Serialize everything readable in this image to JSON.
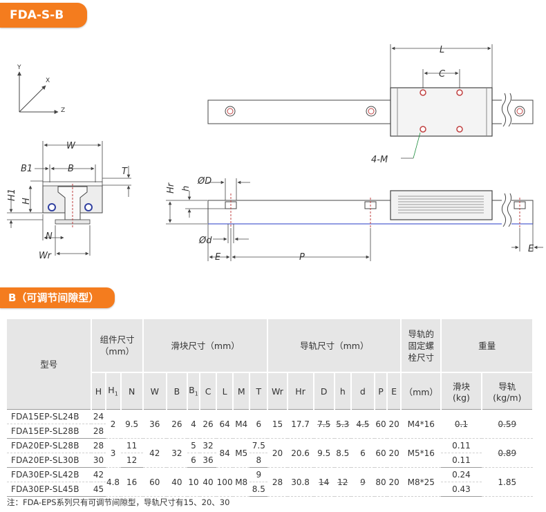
{
  "top_tag": "FDA-S-B",
  "section_tag": "B（可调节间隙型）",
  "axes": {
    "y": "Y",
    "x": "X",
    "z": "Z"
  },
  "dims": {
    "W": "W",
    "B1": "B1",
    "B": "B",
    "T": "T",
    "H1": "H1",
    "H": "H",
    "N": "N",
    "Wr": "Wr",
    "L": "L",
    "C": "C",
    "M4": "4-M",
    "Hr": "Hr",
    "h": "h",
    "D": "ØD",
    "d": "Ød",
    "E": "E",
    "P": "P",
    "E2": "E"
  },
  "table": {
    "headers": {
      "model": "型号",
      "assembly_line1": "组件尺寸",
      "assembly_line2": "（mm）",
      "block": "滑块尺寸（mm）",
      "rail": "导轨尺寸（mm）",
      "bolt_l1": "导轨的",
      "bolt_l2": "固定螺",
      "bolt_l3": "栓尺寸",
      "weight": "重量"
    },
    "subheaders": {
      "H": "H",
      "H1": "H1",
      "N": "N",
      "W": "W",
      "B": "B",
      "B1": "B1",
      "C": "C",
      "L": "L",
      "M": "M",
      "T": "T",
      "Wr": "Wr",
      "Hr": "Hr",
      "D": "D",
      "h": "h",
      "d": "d",
      "P": "P",
      "E": "E",
      "bolt": "（mm）",
      "w_block_l1": "滑块",
      "w_block_l2": "(kg)",
      "w_rail_l1": "导轨",
      "w_rail_l2": "(kg/m)"
    },
    "groups": [
      {
        "rows": [
          {
            "model": "FDA15EP-SL24B",
            "H": "24"
          },
          {
            "model": "FDA15EP-SL28B",
            "H": "28"
          }
        ],
        "H1": "2",
        "N": "9.5",
        "W": "36",
        "B": "26",
        "B1": "4",
        "C": "26",
        "L": "64",
        "M": "M4",
        "T": "6",
        "Wr": "15",
        "Hr": "17.7",
        "D": "7.5",
        "h": "5.3",
        "d": "4.5",
        "P": "60",
        "E": "20",
        "bolt": "M4*16",
        "w_block": "0.1",
        "w_rail": "0.59"
      },
      {
        "rows": [
          {
            "model": "FDA20EP-SL28B",
            "H": "28",
            "N": "11",
            "B1": "5",
            "C": "32",
            "T": "7.5",
            "w_block": "0.11"
          },
          {
            "model": "FDA20EP-SL30B",
            "H": "30",
            "N": "12",
            "B1": "6",
            "C": "36",
            "T": "8",
            "w_block": "0.11"
          }
        ],
        "H1": "3",
        "W": "42",
        "B": "32",
        "L": "84",
        "M": "M5",
        "Wr": "20",
        "Hr": "20.6",
        "D": "9.5",
        "h": "8.5",
        "d": "6",
        "P": "60",
        "E": "20",
        "bolt": "M5*16",
        "w_rail": "0.89"
      },
      {
        "rows": [
          {
            "model": "FDA30EP-SL42B",
            "H": "42",
            "T": "9",
            "w_block": "0.24"
          },
          {
            "model": "FDA30EP-SL45B",
            "H": "45",
            "T": "8.5",
            "w_block": "0.43"
          }
        ],
        "H1": "4.8",
        "N": "16",
        "W": "60",
        "B": "40",
        "B1": "10",
        "C": "40",
        "L": "100",
        "M": "M8",
        "Wr": "28",
        "Hr": "30.8",
        "D": "14",
        "h": "12",
        "d": "9",
        "P": "80",
        "E": "20",
        "bolt": "M8*25",
        "w_rail": "1.85"
      }
    ]
  },
  "note": "注：FDA-EPS系列只有可调节间隙型，导轨尺寸有15、20、30"
}
